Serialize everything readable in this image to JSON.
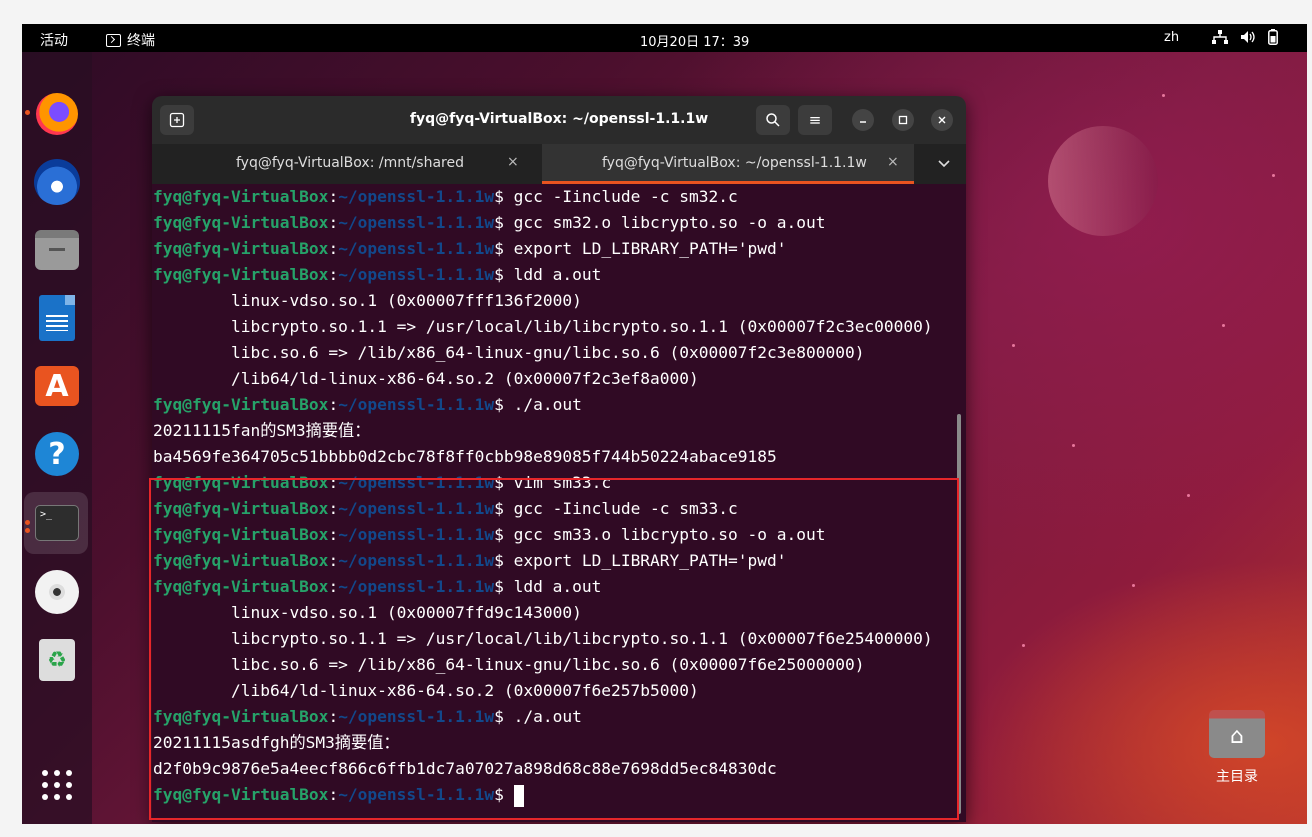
{
  "topbar": {
    "activities": "活动",
    "app_name": "终端",
    "clock": "10月20日  17：39",
    "lang": "zh",
    "icons": [
      "network-icon",
      "volume-icon",
      "battery-icon"
    ]
  },
  "dock": {
    "items": [
      "firefox",
      "thunderbird",
      "files",
      "libreoffice-writer",
      "app-center",
      "help",
      "terminal",
      "disc",
      "trash",
      "show-apps"
    ]
  },
  "desktop": {
    "home_folder_label": "主目录"
  },
  "window": {
    "title": "fyq@fyq-VirtualBox: ~/openssl-1.1.1w",
    "tabs": [
      {
        "label": "fyq@fyq-VirtualBox: /mnt/shared",
        "close": "×"
      },
      {
        "label": "fyq@fyq-VirtualBox: ~/openssl-1.1.1w",
        "close": "×"
      }
    ],
    "new_tab_icon": "+",
    "menu_icon": "≡",
    "search_icon": "⌕",
    "tabs_menu": "⌄"
  },
  "terminal": {
    "user_host": "fyq@fyq-VirtualBox",
    "sep": ":",
    "path": "~/openssl-1.1.1w",
    "prompt_end": "$ ",
    "lines": [
      {
        "type": "prompt",
        "cmd": "gcc -Iinclude -c sm32.c"
      },
      {
        "type": "prompt",
        "cmd": "gcc sm32.o libcrypto.so -o a.out"
      },
      {
        "type": "prompt",
        "cmd": "export LD_LIBRARY_PATH='pwd'"
      },
      {
        "type": "prompt",
        "cmd": "ldd a.out"
      },
      {
        "type": "out",
        "text": "        linux-vdso.so.1 (0x00007fff136f2000)"
      },
      {
        "type": "out",
        "text": "        libcrypto.so.1.1 => /usr/local/lib/libcrypto.so.1.1 (0x00007f2c3ec00000)"
      },
      {
        "type": "out",
        "text": "        libc.so.6 => /lib/x86_64-linux-gnu/libc.so.6 (0x00007f2c3e800000)"
      },
      {
        "type": "out",
        "text": "        /lib64/ld-linux-x86-64.so.2 (0x00007f2c3ef8a000)"
      },
      {
        "type": "prompt",
        "cmd": "./a.out"
      },
      {
        "type": "out",
        "text": "20211115fan的SM3摘要值："
      },
      {
        "type": "out",
        "text": "ba4569fe364705c51bbbb0d2cbc78f8ff0cbb98e89085f744b50224abace9185"
      },
      {
        "type": "prompt",
        "cmd": "vim sm33.c"
      },
      {
        "type": "prompt",
        "cmd": "gcc -Iinclude -c sm33.c"
      },
      {
        "type": "prompt",
        "cmd": "gcc sm33.o libcrypto.so -o a.out"
      },
      {
        "type": "prompt",
        "cmd": "export LD_LIBRARY_PATH='pwd'"
      },
      {
        "type": "prompt",
        "cmd": "ldd a.out"
      },
      {
        "type": "out",
        "text": "        linux-vdso.so.1 (0x00007ffd9c143000)"
      },
      {
        "type": "out",
        "text": "        libcrypto.so.1.1 => /usr/local/lib/libcrypto.so.1.1 (0x00007f6e25400000)"
      },
      {
        "type": "out",
        "text": "        libc.so.6 => /lib/x86_64-linux-gnu/libc.so.6 (0x00007f6e25000000)"
      },
      {
        "type": "out",
        "text": "        /lib64/ld-linux-x86-64.so.2 (0x00007f6e257b5000)"
      },
      {
        "type": "prompt",
        "cmd": "./a.out"
      },
      {
        "type": "out",
        "text": "20211115asdfgh的SM3摘要值："
      },
      {
        "type": "out",
        "text": "d2f0b9c9876e5a4eecf866c6ffb1dc7a07027a898d68c88e7698dd5ec84830dc"
      },
      {
        "type": "prompt",
        "cmd": ""
      }
    ]
  },
  "colors": {
    "terminal_bg": "#300a24",
    "user_host": "#26a269",
    "path": "#12488b",
    "accent": "#e95420",
    "highlight_border": "#e6262a"
  }
}
